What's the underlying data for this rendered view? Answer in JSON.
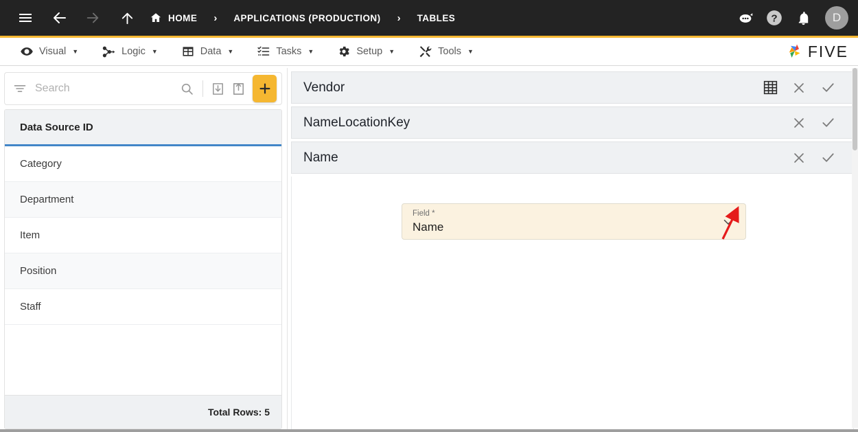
{
  "topbar": {
    "menu_icon": "hamburger-menu-icon",
    "back_icon": "arrow-left-icon",
    "forward_icon": "arrow-right-icon",
    "up_icon": "arrow-up-icon",
    "breadcrumbs": [
      {
        "label": "HOME",
        "icon": "home-icon"
      },
      {
        "label": "APPLICATIONS (PRODUCTION)",
        "icon": ""
      },
      {
        "label": "TABLES",
        "icon": ""
      }
    ],
    "separator": "›",
    "actions": [
      {
        "name": "chatbot-icon",
        "label": ""
      },
      {
        "name": "help-icon",
        "label": ""
      },
      {
        "name": "notifications-bell-icon",
        "label": ""
      }
    ],
    "avatar_initial": "D",
    "accent_color": "#F5B731",
    "background_color": "#232323"
  },
  "menubar": {
    "items": [
      {
        "label": "Visual",
        "icon": "eye-icon"
      },
      {
        "label": "Logic",
        "icon": "flow-nodes-icon"
      },
      {
        "label": "Data",
        "icon": "table-icon"
      },
      {
        "label": "Tasks",
        "icon": "checklist-icon"
      },
      {
        "label": "Setup",
        "icon": "gear-icon"
      },
      {
        "label": "Tools",
        "icon": "tools-icon"
      }
    ],
    "caret": "▼",
    "brand": "FIVE"
  },
  "sidebar": {
    "search": {
      "placeholder": "Search",
      "value": ""
    },
    "toolbar": [
      {
        "name": "filter-icon"
      },
      {
        "name": "search-icon"
      },
      {
        "name": "import-icon"
      },
      {
        "name": "export-icon"
      },
      {
        "name": "add-button",
        "label": "+"
      }
    ],
    "list_header": "Data Source ID",
    "rows": [
      {
        "label": "Category"
      },
      {
        "label": "Department"
      },
      {
        "label": "Item"
      },
      {
        "label": "Position"
      },
      {
        "label": "Staff"
      }
    ],
    "footer": "Total Rows: 5"
  },
  "main": {
    "panels": [
      {
        "title": "Vendor",
        "actions": [
          {
            "name": "grid-view-icon"
          },
          {
            "name": "close-icon"
          },
          {
            "name": "confirm-check-icon"
          }
        ]
      },
      {
        "title": "NameLocationKey",
        "actions": [
          {
            "name": "close-icon"
          },
          {
            "name": "confirm-check-icon"
          }
        ]
      },
      {
        "title": "Name",
        "actions": [
          {
            "name": "close-icon"
          },
          {
            "name": "confirm-check-icon"
          }
        ]
      }
    ],
    "field_select": {
      "label": "Field *",
      "value": "Name",
      "chevron": "chevron-down-icon",
      "background_color": "#FBF2E0"
    },
    "annotation": {
      "name": "red-arrow-annotation",
      "color": "#E51B1B"
    }
  }
}
